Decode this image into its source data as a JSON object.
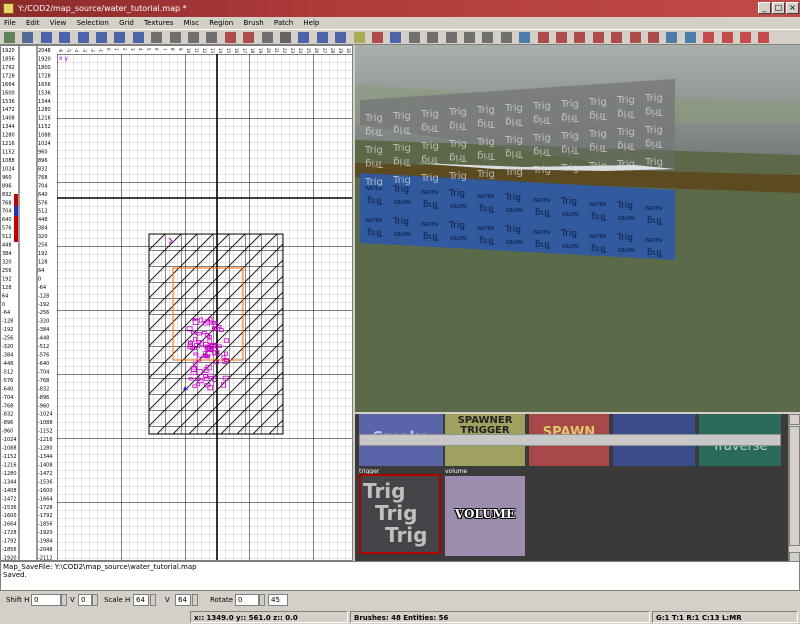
{
  "window": {
    "title": "Y:/COD2/map_source/water_tutorial.map *",
    "minimize": "_",
    "maximize": "□",
    "close": "×"
  },
  "menu": [
    "File",
    "Edit",
    "View",
    "Selection",
    "Grid",
    "Textures",
    "Misc",
    "Region",
    "Brush",
    "Patch",
    "Help"
  ],
  "grid_view": {
    "col1_labels": [
      "1920",
      "1856",
      "1792",
      "1728",
      "1664",
      "1600",
      "1536",
      "1472",
      "1408",
      "1344",
      "1280",
      "1216",
      "1152",
      "1088",
      "1024",
      "960",
      "896",
      "832",
      "768",
      "704",
      "640",
      "576",
      "512",
      "448",
      "384",
      "320",
      "256",
      "192",
      "128",
      "64",
      "0",
      "-64",
      "-128",
      "-192",
      "-256",
      "-320",
      "-384",
      "-448",
      "-512",
      "-576",
      "-640",
      "-704",
      "-768",
      "-832",
      "-896",
      "-960",
      "-1024",
      "-1088",
      "-1152",
      "-1216",
      "-1280",
      "-1344",
      "-1408",
      "-1472",
      "-1536",
      "-1600",
      "-1664",
      "-1728",
      "-1792",
      "-1856",
      "-1920"
    ],
    "col2_labels": [
      "2048",
      "1920",
      "1800",
      "1728",
      "1656",
      "1536",
      "1344",
      "1280",
      "1216",
      "1152",
      "1088",
      "1024",
      "960",
      "896",
      "832",
      "768",
      "704",
      "640",
      "576",
      "512",
      "448",
      "384",
      "320",
      "256",
      "192",
      "128",
      "64",
      "0",
      "-64",
      "-128",
      "-192",
      "-256",
      "-320",
      "-384",
      "-448",
      "-512",
      "-576",
      "-640",
      "-704",
      "-768",
      "-832",
      "-896",
      "-960",
      "-1024",
      "-1088",
      "-1152",
      "-1216",
      "-1280",
      "-1344",
      "-1408",
      "-1472",
      "-1536",
      "-1600",
      "-1664",
      "-1728",
      "-1792",
      "-1856",
      "-1920",
      "-1984",
      "-2048",
      "-2112"
    ],
    "top_labels": [
      "-6",
      "-5",
      "-4",
      "-3",
      "-2",
      "-1",
      "0",
      "1",
      "2",
      "3",
      "4",
      "5",
      "6",
      "7",
      "8",
      "9",
      "10",
      "11",
      "12",
      "13",
      "14",
      "15",
      "16",
      "17",
      "18",
      "19",
      "20",
      "21",
      "22",
      "23",
      "24",
      "25",
      "26",
      "27",
      "28",
      "29",
      "30",
      "31",
      "32",
      "33",
      "34",
      "35",
      "36",
      "37",
      "38",
      "39",
      "40",
      "41",
      "42",
      "43",
      "44",
      "45",
      "46",
      "47",
      "48",
      "49"
    ],
    "corner_marker": "x y"
  },
  "view3d": {
    "trig_text": "Trig",
    "water_text": "WATER"
  },
  "textures": {
    "row1": [
      {
        "name": "smoke",
        "label": "Smoke",
        "color": "#5a64a8"
      },
      {
        "name": "spawner-trigger",
        "label": "SPAWNER TRIGGER",
        "color": "#a0a060"
      },
      {
        "name": "spawn",
        "label": "SPAWN",
        "color": "#a84848"
      },
      {
        "name": "blue",
        "label": "",
        "color": "#3a4c8c"
      },
      {
        "name": "traverse",
        "label": "Traverse",
        "color": "#2a6a5a"
      }
    ],
    "row2": [
      {
        "name": "trigger",
        "caption": "trigger",
        "lines": [
          "Trig",
          "Trig",
          "Trig"
        ],
        "color": "#454549"
      },
      {
        "name": "volume",
        "caption": "volume",
        "label": "VOLUME",
        "color": "#9c8cae"
      }
    ]
  },
  "console": {
    "lines": [
      "Map_SaveFile: Y:\\COD2\\map_source\\water_tutorial.map",
      "Saved."
    ]
  },
  "bottombar": {
    "shift_h_label": "Shift H",
    "shift_h": "0",
    "v1_label": "V",
    "v1": "0",
    "scale_h_label": "Scale H",
    "scale_h": "64",
    "v2_label": "V",
    "v2": "64",
    "rotate_label": "Rotate",
    "rotate": "0",
    "rotate_step": "45"
  },
  "status": {
    "coords": "x:: 1349.0  y:: 561.0  z:: 0.0",
    "counts": "Brushes: 48 Entities: 56",
    "grid": "G:1 T:1 R:1 C:13 L:MR"
  },
  "colors": {
    "grid_major": "#000000",
    "selection": "#ff6a00",
    "entity": "#cc00cc",
    "water": "#1e4c9a",
    "trigger": "#ff8000",
    "border_sel": "#b00000"
  }
}
